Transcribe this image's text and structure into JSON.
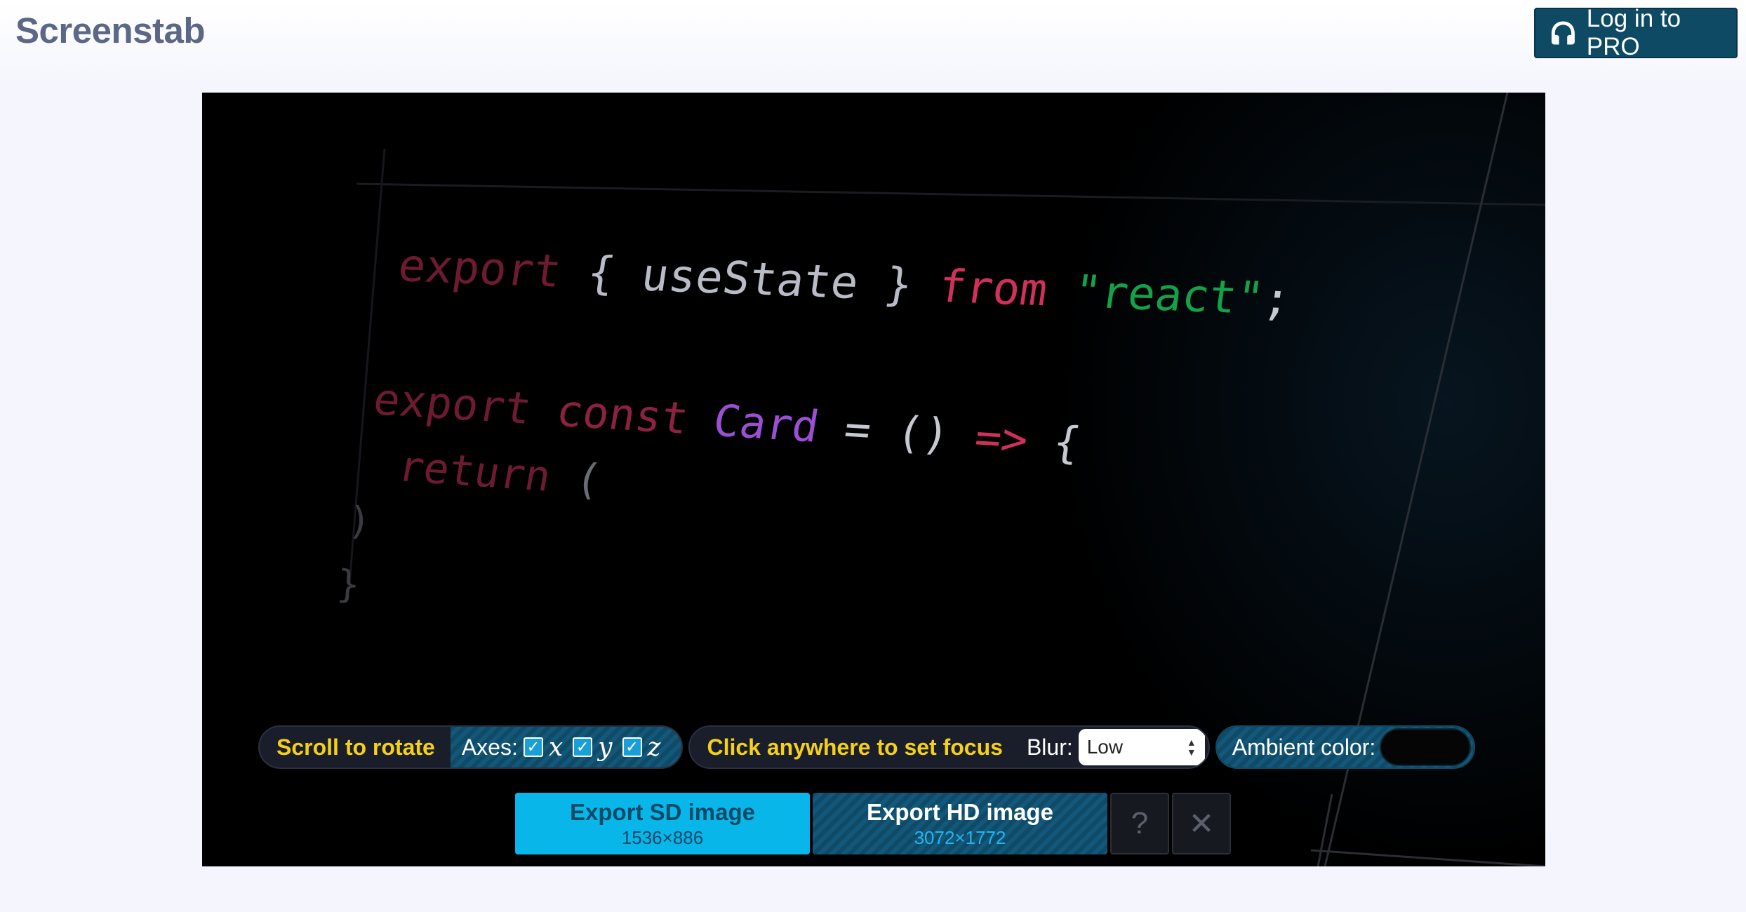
{
  "header": {
    "logo": "Screenstab",
    "login_label": "Log in to PRO"
  },
  "code": {
    "line1": {
      "kw1": "export",
      "mid": " { useState } ",
      "kw2": "from",
      "str": " \"react\"",
      "end": ";"
    },
    "line2": {
      "kw1": "export",
      "kw2": " const ",
      "cls": "Card",
      "eq": " = () ",
      "arrow": "=>",
      "brace": " {"
    },
    "line3": {
      "kw": "return",
      "paren": " ("
    },
    "line4": ")",
    "line5": "}"
  },
  "toolbar": {
    "rotate_label": "Scroll to rotate",
    "axes_label": "Axes:",
    "axes": [
      {
        "name": "x",
        "checked": true
      },
      {
        "name": "y",
        "checked": true
      },
      {
        "name": "z",
        "checked": true
      }
    ],
    "focus_label": "Click anywhere to set focus",
    "blur_label": "Blur:",
    "blur_value": "Low",
    "ambient_label": "Ambient color:"
  },
  "export": {
    "sd_label": "Export SD image",
    "sd_size": "1536×886",
    "hd_label": "Export HD image",
    "hd_size": "3072×1772",
    "help_label": "?",
    "close_label": "✕"
  },
  "colors": {
    "brand": "#5b6785",
    "login_bg": "#0e4a63",
    "accent_yellow": "#f5d116",
    "sd_button": "#09b6ea"
  }
}
